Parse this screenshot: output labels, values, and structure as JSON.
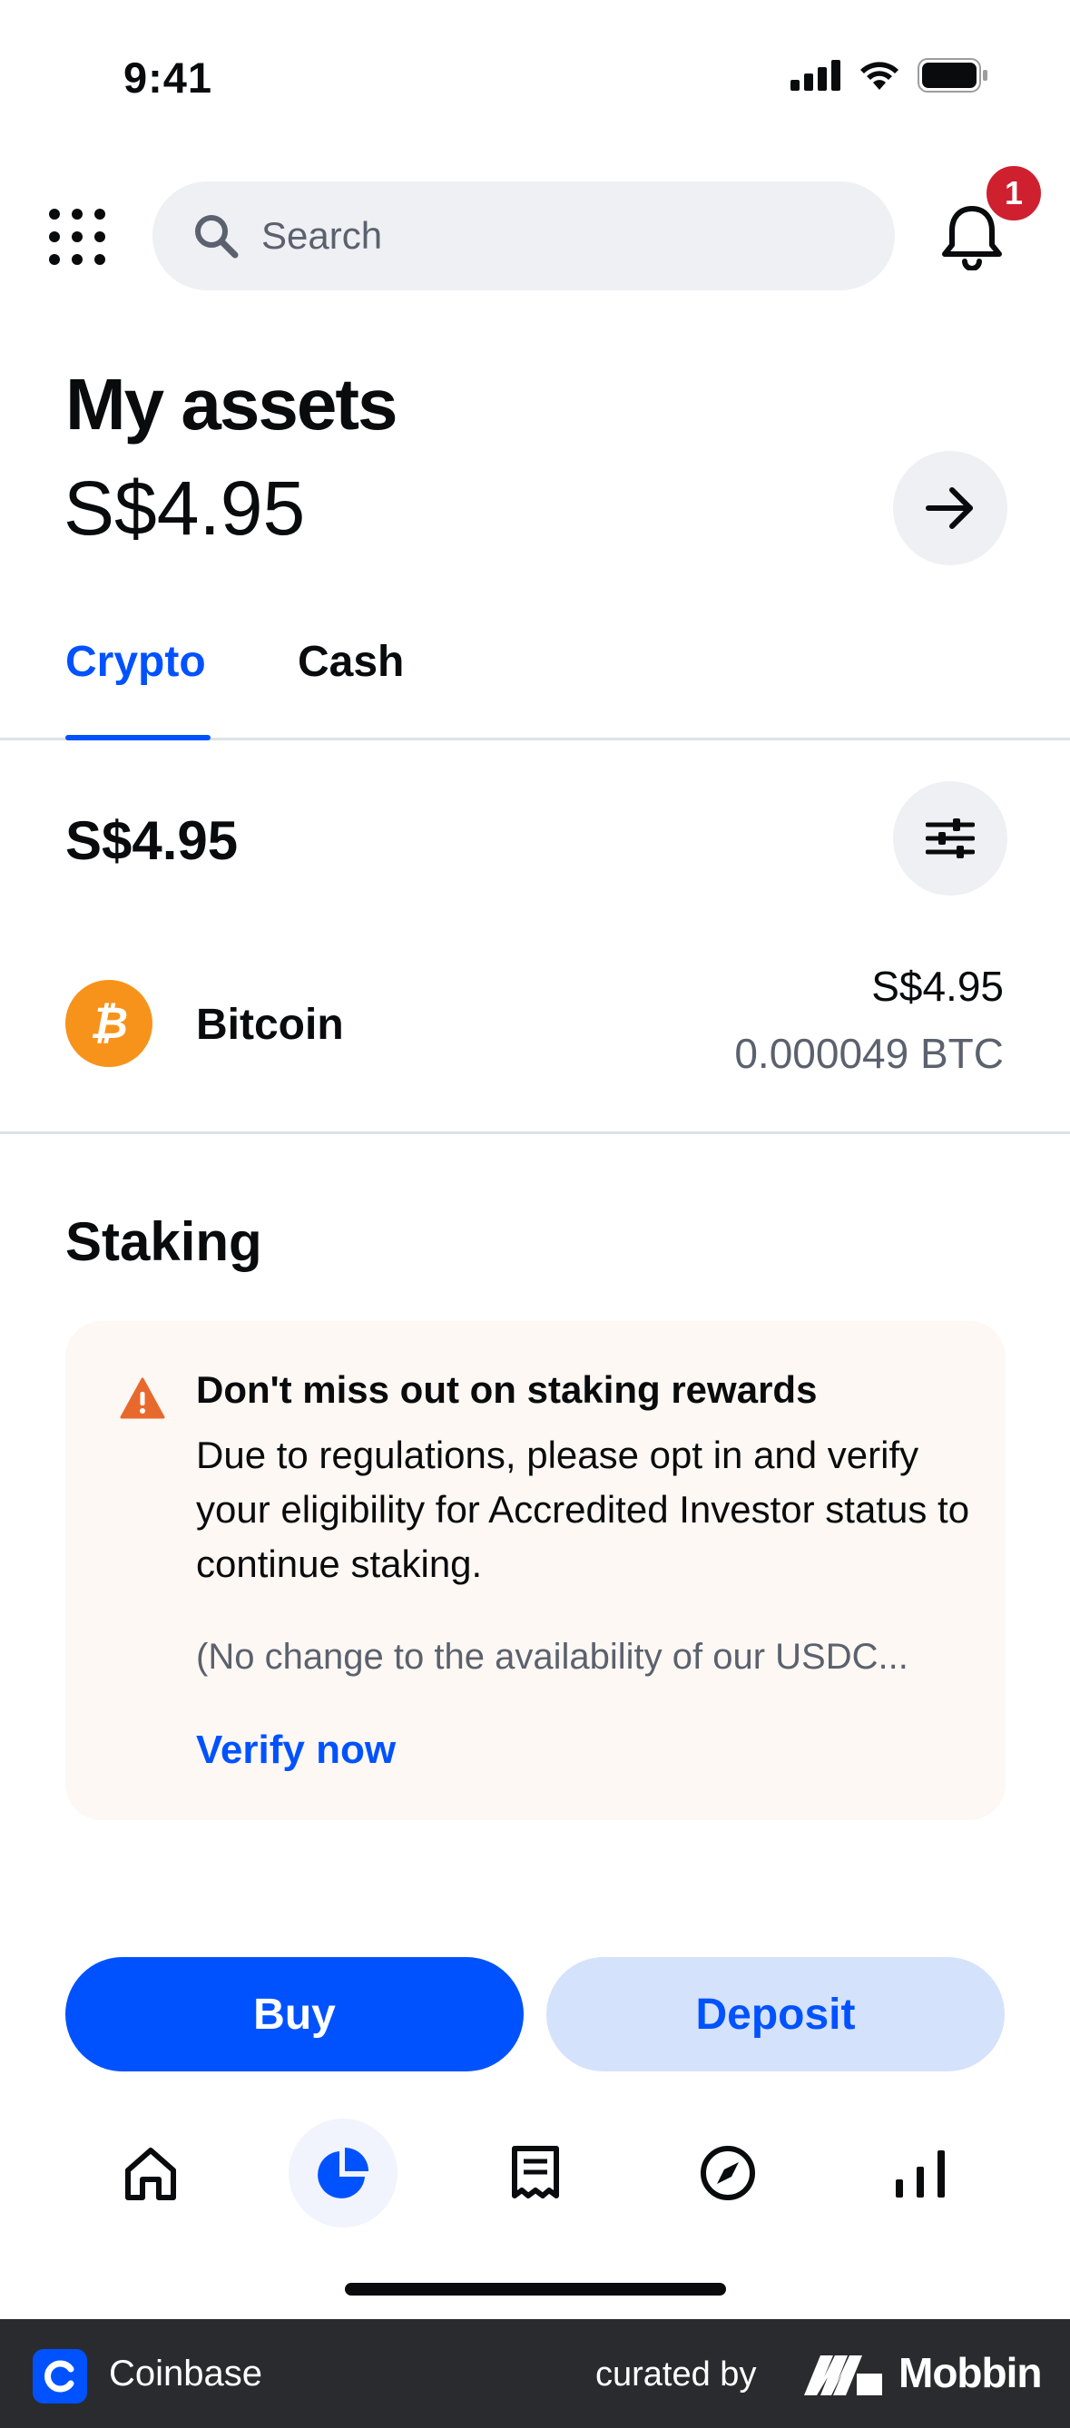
{
  "status_bar": {
    "time": "9:41"
  },
  "header": {
    "search_placeholder": "Search",
    "notification_count": "1"
  },
  "assets": {
    "title": "My assets",
    "total": "S$4.95"
  },
  "tabs": [
    {
      "label": "Crypto",
      "active": true
    },
    {
      "label": "Cash",
      "active": false
    }
  ],
  "crypto": {
    "total": "S$4.95",
    "items": [
      {
        "name": "Bitcoin",
        "fiat_value": "S$4.95",
        "crypto_value": "0.000049 BTC",
        "icon": "bitcoin-icon",
        "color": "#f7931a"
      }
    ]
  },
  "staking": {
    "title": "Staking",
    "card_title": "Don't miss out on staking rewards",
    "card_body": "Due to regulations, please opt in and verify your eligibility for Accredited Investor status to continue staking.",
    "card_note": "(No change to the availability of our USDC...",
    "card_link": "Verify now"
  },
  "actions": {
    "buy": "Buy",
    "deposit": "Deposit"
  },
  "bottom_nav": [
    {
      "icon": "home-icon"
    },
    {
      "icon": "portfolio-icon",
      "active": true
    },
    {
      "icon": "transactions-icon"
    },
    {
      "icon": "explore-icon"
    },
    {
      "icon": "chart-icon"
    }
  ],
  "footer": {
    "app_name": "Coinbase",
    "curated_by": "curated by",
    "brand": "Mobbin"
  },
  "colors": {
    "accent": "#0052ff",
    "badge": "#cf202f",
    "warning": "#e8692d",
    "bitcoin": "#f7931a"
  }
}
